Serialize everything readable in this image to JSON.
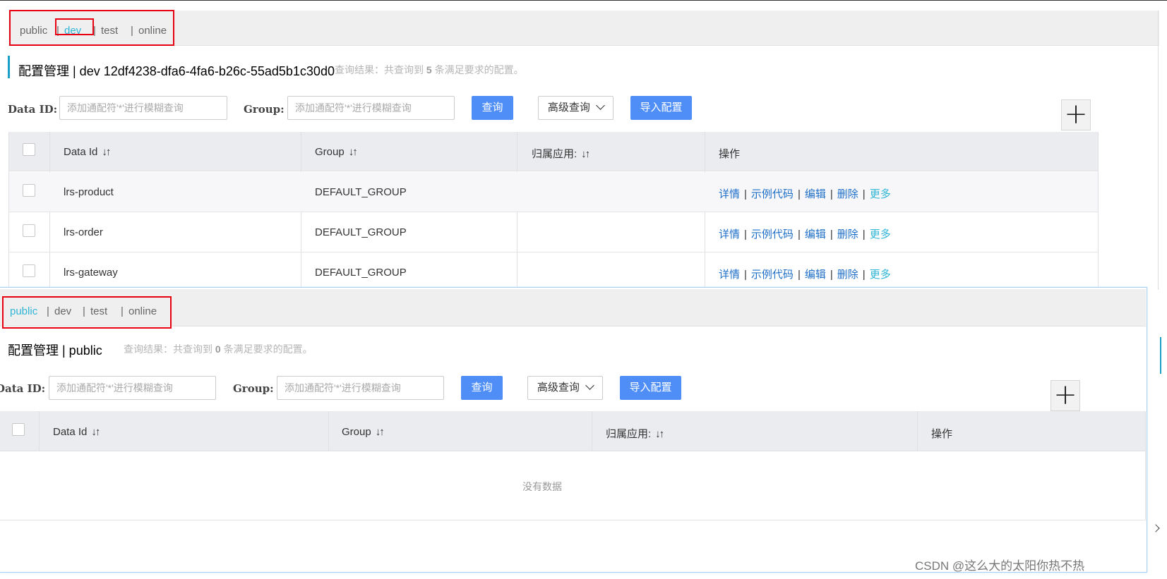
{
  "namespaces": [
    "public",
    "dev",
    "test",
    "online"
  ],
  "separator": "|",
  "panel_back": {
    "active_namespace": "dev",
    "title": "配置管理  |  dev  12df4238-dfa6-4fa6-b26c-55ad5b1c30d0",
    "query_result_prefix": "查询结果：共查询到",
    "query_result_count": "5",
    "query_result_suffix": "条满足要求的配置。",
    "rows": [
      {
        "data_id": "lrs-product",
        "group": "DEFAULT_GROUP",
        "app": ""
      },
      {
        "data_id": "lrs-order",
        "group": "DEFAULT_GROUP",
        "app": ""
      },
      {
        "data_id": "lrs-gateway",
        "group": "DEFAULT_GROUP",
        "app": ""
      }
    ]
  },
  "panel_front": {
    "active_namespace": "public",
    "title": "配置管理  |  public",
    "query_result_prefix": "查询结果：共查询到",
    "query_result_count": "0",
    "query_result_suffix": "条满足要求的配置。",
    "empty_text": "没有数据"
  },
  "form": {
    "data_id_label": "Data ID:",
    "group_label": "Group:",
    "placeholder": "添加通配符'*'进行模糊查询",
    "query_button": "查询",
    "advanced_button": "高级查询",
    "import_button": "导入配置",
    "add_button": "+"
  },
  "table": {
    "headers": [
      "Data Id",
      "Group",
      "归属应用:",
      "操作"
    ],
    "sort_glyph": "↓↑"
  },
  "operations": {
    "detail": "详情",
    "sample_code": "示例代码",
    "edit": "编辑",
    "delete": "删除",
    "more": "更多"
  },
  "colors": {
    "primary_button": "#4f8ef7",
    "link": "#1e6fc8",
    "active_tab": "#2fb5d6",
    "highlight_box": "#e60012"
  },
  "watermark": "CSDN @这么大的太阳你热不热"
}
